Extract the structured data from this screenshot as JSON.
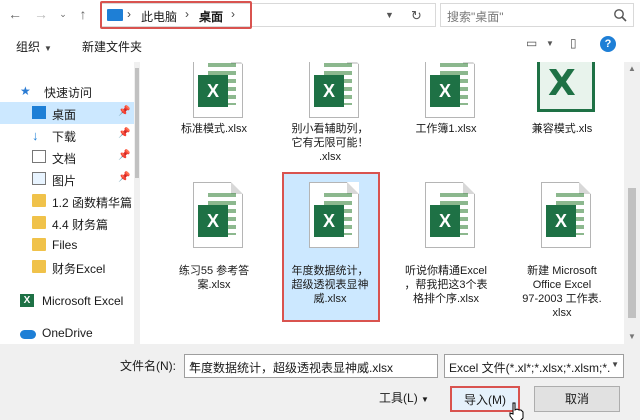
{
  "address": {
    "segments": [
      "此电脑",
      "桌面"
    ],
    "search_placeholder": "搜索\"桌面\""
  },
  "toolbar": {
    "organize": "组织",
    "new_folder": "新建文件夹"
  },
  "sidebar": {
    "items": [
      {
        "label": "快速访问",
        "icon": "star-icon"
      },
      {
        "label": "桌面",
        "icon": "desktop-icon",
        "pinned": true,
        "selected": true
      },
      {
        "label": "下载",
        "icon": "download-icon",
        "pinned": true
      },
      {
        "label": "文档",
        "icon": "document-icon",
        "pinned": true
      },
      {
        "label": "图片",
        "icon": "picture-icon",
        "pinned": true
      },
      {
        "label": "1.2 函数精华篇",
        "icon": "folder-icon"
      },
      {
        "label": "4.4 财务篇",
        "icon": "folder-icon"
      },
      {
        "label": "Files",
        "icon": "folder-icon"
      },
      {
        "label": "财务Excel",
        "icon": "folder-icon"
      },
      {
        "label": "Microsoft Excel",
        "icon": "excel-icon"
      },
      {
        "label": "OneDrive",
        "icon": "cloud-icon"
      }
    ]
  },
  "files": [
    {
      "name": "标准模式.xlsx"
    },
    {
      "name": "别小看辅助列，它有无限可能！.xlsx"
    },
    {
      "name": "工作簿1.xlsx"
    },
    {
      "name": "兼容模式.xls"
    },
    {
      "name": "练习55 参考答案.xlsx"
    },
    {
      "name": "年度数据统计，超级透视表显神威.xlsx",
      "selected": true
    },
    {
      "name": "听说你精通Excel，帮我把这3个表格排个序.xlsx"
    },
    {
      "name": "新建 Microsoft Office Excel 97-2003 工作表.xlsx"
    }
  ],
  "file_labels": {
    "f0": [
      "标准模式.xlsx"
    ],
    "f1": [
      "别小看辅助列，",
      "它有无限可能！",
      ".xlsx"
    ],
    "f2": [
      "工作簿1.xlsx"
    ],
    "f3": [
      "兼容模式.xls"
    ],
    "f4": [
      "练习55 参考答",
      "案.xlsx"
    ],
    "f5": [
      "年度数据统计，",
      "超级透视表显神",
      "威.xlsx"
    ],
    "f6": [
      "听说你精通Excel",
      "，帮我把这3个表",
      "格排个序.xlsx"
    ],
    "f7": [
      "新建 Microsoft",
      "Office Excel",
      "97-2003 工作表.",
      "xlsx"
    ]
  },
  "bottom": {
    "filename_label": "文件名(N):",
    "filename_value": "年度数据统计，超级透视表显神威.xlsx",
    "filter_value": "Excel 文件(*.xl*;*.xlsx;*.xlsm;*.",
    "tools_label": "工具(L)",
    "import_label": "导入(M)",
    "cancel_label": "取消"
  },
  "colors": {
    "excel_green": "#1e7145",
    "selection": "#cce8ff",
    "highlight_red": "#d9534f"
  }
}
